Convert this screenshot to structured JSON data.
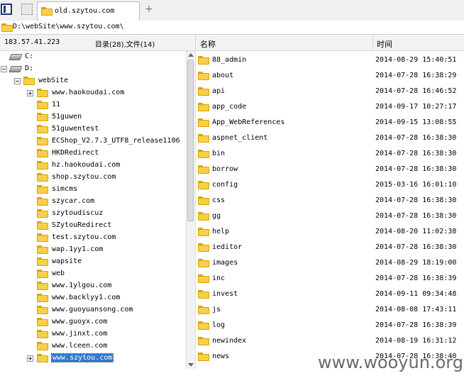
{
  "tab": {
    "label": "old.szytou.com"
  },
  "address": {
    "path": "D:\\webSite\\www.szytou.com\\"
  },
  "header": {
    "ip": "183.57.41.223",
    "summary": "目录(28),文件(14)",
    "col_name": "名称",
    "col_time": "时间"
  },
  "tree": [
    {
      "label": "C:",
      "type": "drive",
      "depth": 0,
      "toggle": ""
    },
    {
      "label": "D:",
      "type": "drive",
      "depth": 0,
      "toggle": "minus"
    },
    {
      "label": "webSite",
      "type": "folder",
      "depth": 1,
      "toggle": "minus"
    },
    {
      "label": "www.haokoudai.com",
      "type": "folder",
      "depth": 2,
      "toggle": "plus"
    },
    {
      "label": "11",
      "type": "folder",
      "depth": 2,
      "toggle": ""
    },
    {
      "label": "51guwen",
      "type": "folder",
      "depth": 2,
      "toggle": ""
    },
    {
      "label": "51guwentest",
      "type": "folder",
      "depth": 2,
      "toggle": ""
    },
    {
      "label": "ECShop_V2.7.3_UTF8_release1106",
      "type": "folder",
      "depth": 2,
      "toggle": ""
    },
    {
      "label": "HKDRedirect",
      "type": "folder",
      "depth": 2,
      "toggle": ""
    },
    {
      "label": "hz.haokoudai.com",
      "type": "folder",
      "depth": 2,
      "toggle": ""
    },
    {
      "label": "shop.szytou.com",
      "type": "folder",
      "depth": 2,
      "toggle": ""
    },
    {
      "label": "simcms",
      "type": "folder",
      "depth": 2,
      "toggle": ""
    },
    {
      "label": "szycar.com",
      "type": "folder",
      "depth": 2,
      "toggle": ""
    },
    {
      "label": "szytoudiscuz",
      "type": "folder",
      "depth": 2,
      "toggle": ""
    },
    {
      "label": "SZytouRedirect",
      "type": "folder",
      "depth": 2,
      "toggle": ""
    },
    {
      "label": "test.szytou.com",
      "type": "folder",
      "depth": 2,
      "toggle": ""
    },
    {
      "label": "wap.1yy1.com",
      "type": "folder",
      "depth": 2,
      "toggle": ""
    },
    {
      "label": "wapsite",
      "type": "folder",
      "depth": 2,
      "toggle": ""
    },
    {
      "label": "web",
      "type": "folder",
      "depth": 2,
      "toggle": ""
    },
    {
      "label": "www.1ylgou.com",
      "type": "folder",
      "depth": 2,
      "toggle": ""
    },
    {
      "label": "www.backlyy1.com",
      "type": "folder",
      "depth": 2,
      "toggle": ""
    },
    {
      "label": "www.guoyuansong.com",
      "type": "folder",
      "depth": 2,
      "toggle": ""
    },
    {
      "label": "www.guoyx.com",
      "type": "folder",
      "depth": 2,
      "toggle": ""
    },
    {
      "label": "www.jinxt.com",
      "type": "folder",
      "depth": 2,
      "toggle": ""
    },
    {
      "label": "www.lceen.com",
      "type": "folder",
      "depth": 2,
      "toggle": ""
    },
    {
      "label": "www.szytou.com",
      "type": "folder",
      "depth": 2,
      "toggle": "plus",
      "selected": true
    }
  ],
  "files": [
    {
      "name": "88_admin",
      "time": "2014-08-29 15:40:51"
    },
    {
      "name": "about",
      "time": "2014-07-28 16:38:29"
    },
    {
      "name": "api",
      "time": "2014-07-28 16:46:52"
    },
    {
      "name": "app_code",
      "time": "2014-09-17 10:27:17"
    },
    {
      "name": "App_WebReferences",
      "time": "2014-09-15 13:08:55"
    },
    {
      "name": "aspnet_client",
      "time": "2014-07-28 16:38:30"
    },
    {
      "name": "bin",
      "time": "2014-07-28 16:38:30"
    },
    {
      "name": "borrow",
      "time": "2014-07-28 16:38:30"
    },
    {
      "name": "config",
      "time": "2015-03-16 16:01:10"
    },
    {
      "name": "css",
      "time": "2014-07-28 16:38:30"
    },
    {
      "name": "gg",
      "time": "2014-07-28 16:38:30"
    },
    {
      "name": "help",
      "time": "2014-08-20 11:02:38"
    },
    {
      "name": "ieditor",
      "time": "2014-07-28 16:38:30"
    },
    {
      "name": "images",
      "time": "2014-08-29 18:19:00"
    },
    {
      "name": "inc",
      "time": "2014-07-28 16:38:39"
    },
    {
      "name": "invest",
      "time": "2014-09-11 09:34:48"
    },
    {
      "name": "js",
      "time": "2014-08-08 17:43:11"
    },
    {
      "name": "log",
      "time": "2014-07-28 16:38:39"
    },
    {
      "name": "newindex",
      "time": "2014-08-19 16:31:12"
    },
    {
      "name": "news",
      "time": "2014-07-28 16:38:40"
    }
  ],
  "watermark": "www.wooyun.org",
  "icons": {
    "folder": "folder-icon",
    "drive": "drive-icon"
  },
  "colors": {
    "selection": "#3077d0",
    "folder": "#f8cf4a"
  }
}
